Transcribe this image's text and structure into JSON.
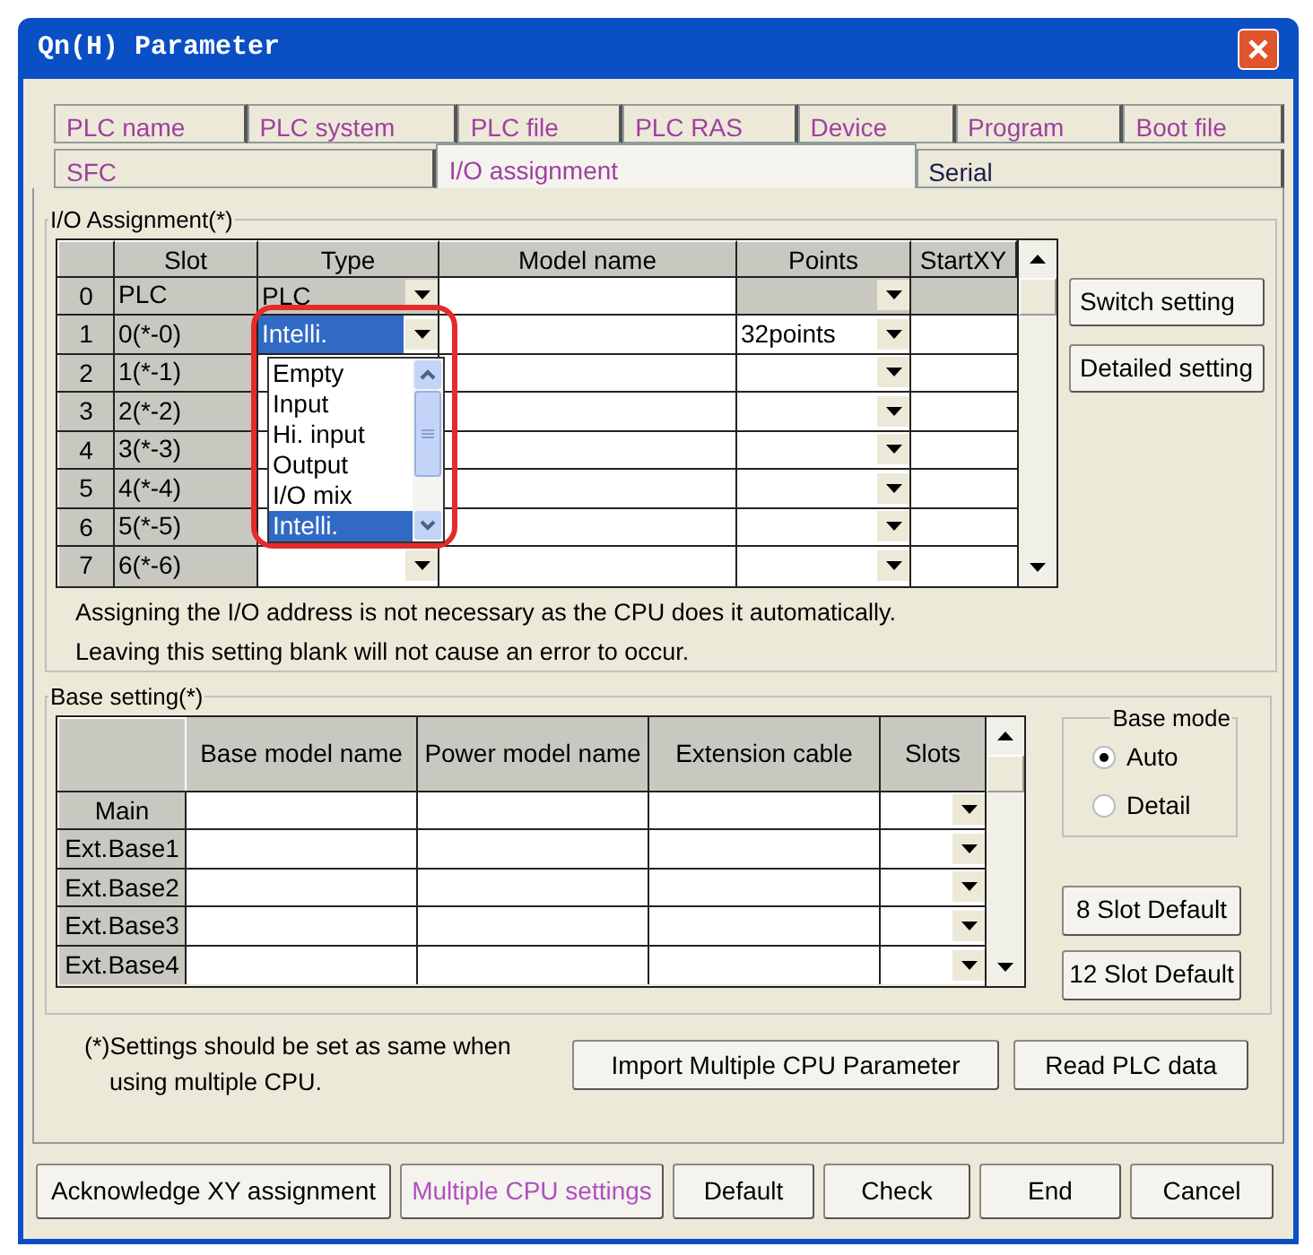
{
  "window": {
    "title": "Qn(H) Parameter"
  },
  "tab_rows": [
    {
      "tabs": [
        {
          "label": "PLC name",
          "selected": false,
          "color": "#a040a0"
        },
        {
          "label": "PLC system",
          "selected": false,
          "color": "#a040a0"
        },
        {
          "label": "PLC file",
          "selected": false,
          "color": "#a040a0"
        },
        {
          "label": "PLC RAS",
          "selected": false,
          "color": "#a040a0"
        },
        {
          "label": "Device",
          "selected": false,
          "color": "#a040a0"
        },
        {
          "label": "Program",
          "selected": false,
          "color": "#a040a0"
        },
        {
          "label": "Boot file",
          "selected": false,
          "color": "#a040a0"
        }
      ]
    },
    {
      "tabs": [
        {
          "label": "SFC",
          "selected": false,
          "color": "#a040a0"
        },
        {
          "label": "I/O assignment",
          "selected": true,
          "color": "#a040a0"
        },
        {
          "label": "Serial",
          "selected": false,
          "color": "#1a1a50"
        }
      ]
    }
  ],
  "io_assignment": {
    "title": "I/O Assignment(*)",
    "columns": [
      "Slot",
      "Type",
      "Model name",
      "Points",
      "StartXY"
    ],
    "rows": [
      {
        "number": "0",
        "slot": "PLC",
        "type": "PLC",
        "fixed": true,
        "editing": false
      },
      {
        "number": "1",
        "slot": "0(*-0)",
        "type": "Intelli.",
        "points": "32points",
        "fixed": false,
        "editing": true
      },
      {
        "number": "2",
        "slot": "1(*-1)",
        "fixed": false,
        "editing": false
      },
      {
        "number": "3",
        "slot": "2(*-2)",
        "fixed": false,
        "editing": false
      },
      {
        "number": "4",
        "slot": "3(*-3)",
        "fixed": false,
        "editing": false
      },
      {
        "number": "5",
        "slot": "4(*-4)",
        "fixed": false,
        "editing": false
      },
      {
        "number": "6",
        "slot": "5(*-5)",
        "fixed": false,
        "editing": false
      },
      {
        "number": "7",
        "slot": "6(*-6)",
        "fixed": false,
        "editing": false
      }
    ],
    "dropdown": {
      "options": [
        {
          "label": "Empty",
          "selected": false
        },
        {
          "label": "Input",
          "selected": false
        },
        {
          "label": "Hi. input",
          "selected": false
        },
        {
          "label": "Output",
          "selected": false
        },
        {
          "label": "I/O mix",
          "selected": false
        },
        {
          "label": "Intelli.",
          "selected": true
        }
      ]
    },
    "notes": [
      "Assigning the I/O address is not necessary as the CPU does it automatically.",
      "Leaving this setting blank will not cause an error to occur."
    ],
    "buttons": [
      "Switch setting",
      "Detailed setting"
    ]
  },
  "base_setting": {
    "title": "Base setting(*)",
    "columns": [
      "Base model name",
      "Power model name",
      "Extension cable",
      "Slots"
    ],
    "rows": [
      "Main",
      "Ext.Base1",
      "Ext.Base2",
      "Ext.Base3",
      "Ext.Base4"
    ],
    "base_mode": {
      "title": "Base mode",
      "options": [
        {
          "label": "Auto",
          "selected": true
        },
        {
          "label": "Detail",
          "selected": false
        }
      ]
    },
    "buttons": [
      "8 Slot Default",
      "12 Slot Default"
    ]
  },
  "footnote": [
    "(*)Settings should be set as same when",
    "using multiple CPU."
  ],
  "panel_buttons": [
    "Import Multiple CPU Parameter",
    "Read PLC data"
  ],
  "bottom_buttons": [
    {
      "label": "Acknowledge XY assignment",
      "color": "#000000"
    },
    {
      "label": "Multiple CPU settings",
      "color": "#b050c0"
    },
    {
      "label": "Default",
      "color": "#000000"
    },
    {
      "label": "Check",
      "color": "#000000"
    },
    {
      "label": "End",
      "color": "#000000"
    },
    {
      "label": "Cancel",
      "color": "#000000"
    }
  ]
}
